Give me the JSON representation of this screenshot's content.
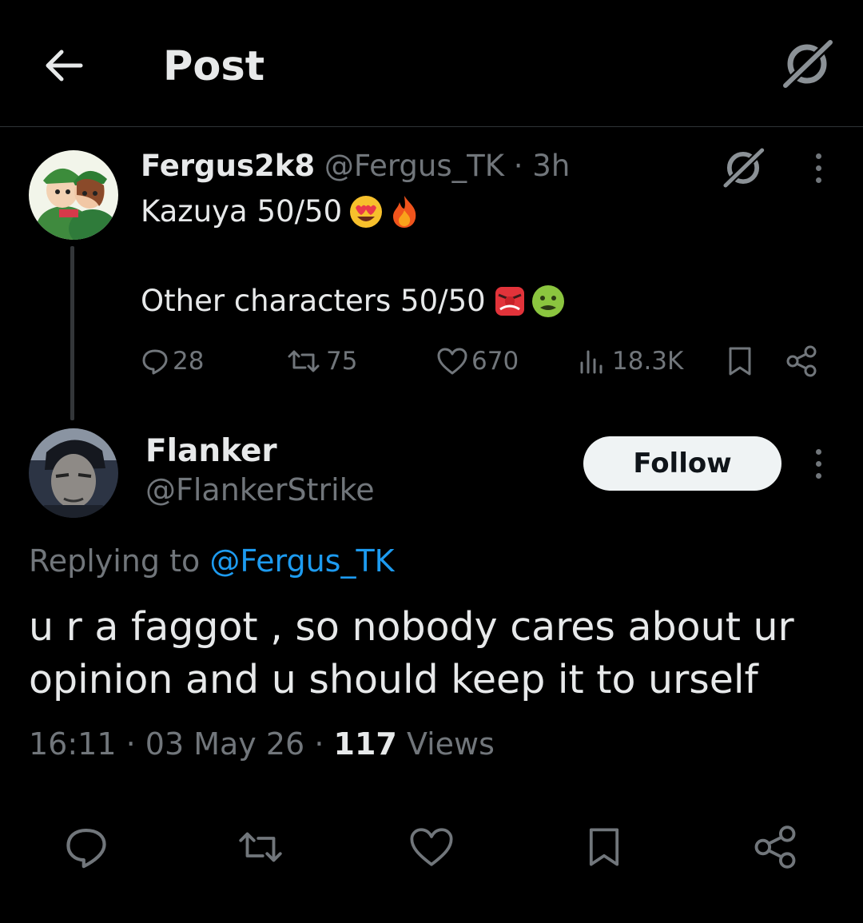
{
  "header": {
    "title": "Post",
    "back_icon": "arrow-left-icon",
    "grok_icon": "grok-icon"
  },
  "parent_post": {
    "display_name": "Fergus2k8",
    "handle": "@Fergus_TK",
    "separator": "·",
    "time": "3h",
    "line1": "Kazuya 50/50",
    "line1_emojis": [
      "heart-eyes-emoji",
      "fire-emoji"
    ],
    "line2": "Other characters 50/50",
    "line2_emojis": [
      "goblin-mask-emoji",
      "nauseated-face-emoji"
    ],
    "stats": {
      "replies": "28",
      "reposts": "75",
      "likes": "670",
      "views": "18.3K"
    }
  },
  "reply_post": {
    "display_name": "Flanker",
    "handle": "@FlankerStrike",
    "follow_label": "Follow",
    "replying_prefix": "Replying to",
    "replying_to": "@Fergus_TK",
    "body_line1": "u r a faggot , so nobody cares about ur",
    "body_line2": "opinion and u should keep it to urself",
    "time": "16:11",
    "date": "03 May 26",
    "dot": "·",
    "views_count": "117",
    "views_label": "Views"
  },
  "action_bar": [
    "reply-icon",
    "repost-icon",
    "like-icon",
    "bookmark-icon",
    "share-icon"
  ],
  "colors": {
    "background": "#000000",
    "text": "#e7e9ea",
    "muted": "#71767b",
    "link": "#1d9bf0",
    "divider": "#2f3336"
  }
}
